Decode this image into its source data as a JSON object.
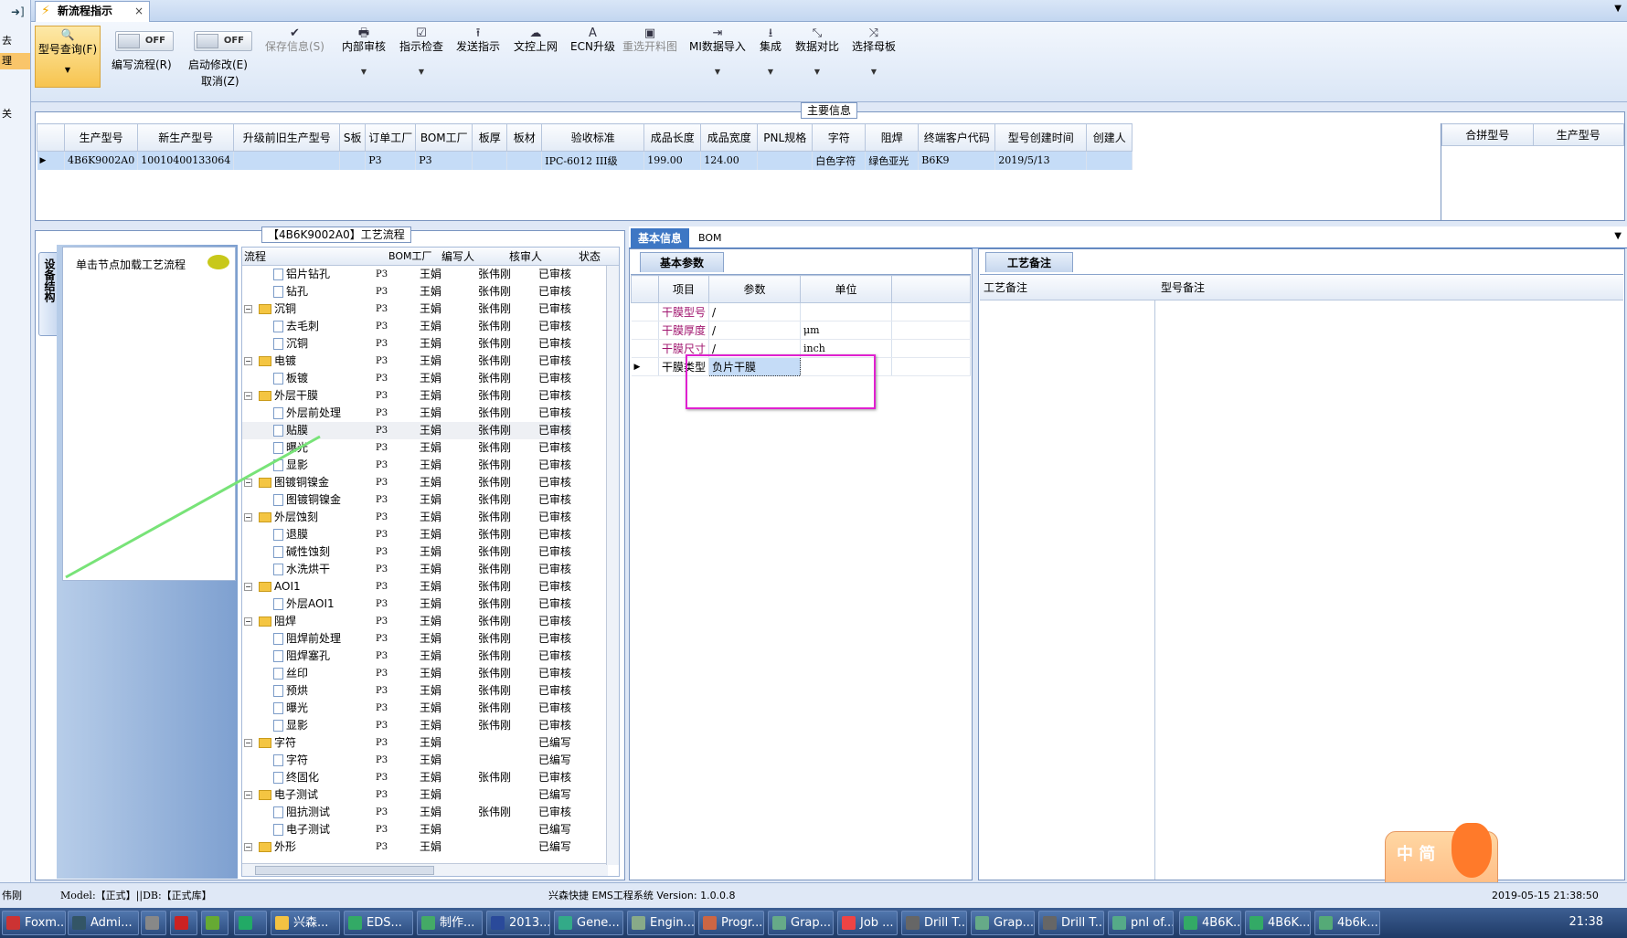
{
  "left_strip": {
    "items": [
      "去",
      "理",
      "关"
    ]
  },
  "tab": {
    "title": "新流程指示",
    "close": "×"
  },
  "ribbon": {
    "model_query": "型号查询(F)",
    "write_flow": "编写流程(R)",
    "start_modify": "启动修改(E)",
    "cancel": "取消(Z)",
    "toggle_off": "OFF",
    "buttons": [
      "保存信息(S)",
      "内部审核",
      "指示检查",
      "发送指示",
      "文控上网",
      "ECN升级",
      "重选开料图",
      "MI数据导入",
      "集成",
      "数据对比",
      "选择母板"
    ]
  },
  "main_info": {
    "section_title": "主要信息",
    "columns": [
      "生产型号",
      "新生产型号",
      "升级前旧生产型号",
      "S板",
      "订单工厂",
      "BOM工厂",
      "板厚",
      "板材",
      "验收标准",
      "成品长度",
      "成品宽度",
      "PNL规格",
      "字符",
      "阻焊",
      "终端客户代码",
      "型号创建时间",
      "创建人"
    ],
    "row": [
      "4B6K9002A0",
      "10010400133064",
      "",
      "",
      "P3",
      "P3",
      "",
      "",
      "IPC-6012 III级",
      "199.00",
      "124.00",
      "",
      "白色字符",
      "绿色亚光",
      "B6K9",
      "2019/5/13",
      ""
    ],
    "side_columns": [
      "合拼型号",
      "生产型号"
    ]
  },
  "flow_panel": {
    "title": "【4B6K9002A0】工艺流程",
    "vertical_tab": "设备结构",
    "hint": "单击节点加载工艺流程",
    "columns": [
      "流程",
      "BOM工厂",
      "编写人",
      "核审人",
      "状态"
    ],
    "rows": [
      {
        "level": 2,
        "type": "doc",
        "name": "铝片钻孔",
        "bom": "P3",
        "writer": "王娟",
        "reviewer": "张伟刚",
        "status": "已审核"
      },
      {
        "level": 2,
        "type": "doc",
        "name": "钻孔",
        "bom": "P3",
        "writer": "王娟",
        "reviewer": "张伟刚",
        "status": "已审核"
      },
      {
        "level": 1,
        "type": "folder",
        "name": "沉铜",
        "bom": "P3",
        "writer": "王娟",
        "reviewer": "张伟刚",
        "status": "已审核"
      },
      {
        "level": 2,
        "type": "doc",
        "name": "去毛刺",
        "bom": "P3",
        "writer": "王娟",
        "reviewer": "张伟刚",
        "status": "已审核"
      },
      {
        "level": 2,
        "type": "doc",
        "name": "沉铜",
        "bom": "P3",
        "writer": "王娟",
        "reviewer": "张伟刚",
        "status": "已审核"
      },
      {
        "level": 1,
        "type": "folder",
        "name": "电镀",
        "bom": "P3",
        "writer": "王娟",
        "reviewer": "张伟刚",
        "status": "已审核"
      },
      {
        "level": 2,
        "type": "doc",
        "name": "板镀",
        "bom": "P3",
        "writer": "王娟",
        "reviewer": "张伟刚",
        "status": "已审核"
      },
      {
        "level": 1,
        "type": "folder",
        "name": "外层干膜",
        "bom": "P3",
        "writer": "王娟",
        "reviewer": "张伟刚",
        "status": "已审核"
      },
      {
        "level": 2,
        "type": "doc",
        "name": "外层前处理",
        "bom": "P3",
        "writer": "王娟",
        "reviewer": "张伟刚",
        "status": "已审核"
      },
      {
        "level": 2,
        "type": "doc",
        "name": "贴膜",
        "bom": "P3",
        "writer": "王娟",
        "reviewer": "张伟刚",
        "status": "已审核"
      },
      {
        "level": 2,
        "type": "doc",
        "name": "曝光",
        "bom": "P3",
        "writer": "王娟",
        "reviewer": "张伟刚",
        "status": "已审核"
      },
      {
        "level": 2,
        "type": "doc",
        "name": "显影",
        "bom": "P3",
        "writer": "王娟",
        "reviewer": "张伟刚",
        "status": "已审核"
      },
      {
        "level": 1,
        "type": "folder",
        "name": "图镀铜镍金",
        "bom": "P3",
        "writer": "王娟",
        "reviewer": "张伟刚",
        "status": "已审核"
      },
      {
        "level": 2,
        "type": "doc",
        "name": "图镀铜镍金",
        "bom": "P3",
        "writer": "王娟",
        "reviewer": "张伟刚",
        "status": "已审核"
      },
      {
        "level": 1,
        "type": "folder",
        "name": "外层蚀刻",
        "bom": "P3",
        "writer": "王娟",
        "reviewer": "张伟刚",
        "status": "已审核"
      },
      {
        "level": 2,
        "type": "doc",
        "name": "退膜",
        "bom": "P3",
        "writer": "王娟",
        "reviewer": "张伟刚",
        "status": "已审核"
      },
      {
        "level": 2,
        "type": "doc",
        "name": "碱性蚀刻",
        "bom": "P3",
        "writer": "王娟",
        "reviewer": "张伟刚",
        "status": "已审核"
      },
      {
        "level": 2,
        "type": "doc",
        "name": "水洗烘干",
        "bom": "P3",
        "writer": "王娟",
        "reviewer": "张伟刚",
        "status": "已审核"
      },
      {
        "level": 1,
        "type": "folder",
        "name": "AOI1",
        "bom": "P3",
        "writer": "王娟",
        "reviewer": "张伟刚",
        "status": "已审核"
      },
      {
        "level": 2,
        "type": "doc",
        "name": "外层AOI1",
        "bom": "P3",
        "writer": "王娟",
        "reviewer": "张伟刚",
        "status": "已审核"
      },
      {
        "level": 1,
        "type": "folder",
        "name": "阻焊",
        "bom": "P3",
        "writer": "王娟",
        "reviewer": "张伟刚",
        "status": "已审核"
      },
      {
        "level": 2,
        "type": "doc",
        "name": "阻焊前处理",
        "bom": "P3",
        "writer": "王娟",
        "reviewer": "张伟刚",
        "status": "已审核"
      },
      {
        "level": 2,
        "type": "doc",
        "name": "阻焊塞孔",
        "bom": "P3",
        "writer": "王娟",
        "reviewer": "张伟刚",
        "status": "已审核"
      },
      {
        "level": 2,
        "type": "doc",
        "name": "丝印",
        "bom": "P3",
        "writer": "王娟",
        "reviewer": "张伟刚",
        "status": "已审核"
      },
      {
        "level": 2,
        "type": "doc",
        "name": "预烘",
        "bom": "P3",
        "writer": "王娟",
        "reviewer": "张伟刚",
        "status": "已审核"
      },
      {
        "level": 2,
        "type": "doc",
        "name": "曝光",
        "bom": "P3",
        "writer": "王娟",
        "reviewer": "张伟刚",
        "status": "已审核"
      },
      {
        "level": 2,
        "type": "doc",
        "name": "显影",
        "bom": "P3",
        "writer": "王娟",
        "reviewer": "张伟刚",
        "status": "已审核"
      },
      {
        "level": 1,
        "type": "folder",
        "name": "字符",
        "bom": "P3",
        "writer": "王娟",
        "reviewer": "",
        "status": "已编写"
      },
      {
        "level": 2,
        "type": "doc",
        "name": "字符",
        "bom": "P3",
        "writer": "王娟",
        "reviewer": "",
        "status": "已编写"
      },
      {
        "level": 2,
        "type": "doc",
        "name": "终固化",
        "bom": "P3",
        "writer": "王娟",
        "reviewer": "张伟刚",
        "status": "已审核"
      },
      {
        "level": 1,
        "type": "folder",
        "name": "电子测试",
        "bom": "P3",
        "writer": "王娟",
        "reviewer": "",
        "status": "已编写"
      },
      {
        "level": 2,
        "type": "doc",
        "name": "阻抗测试",
        "bom": "P3",
        "writer": "王娟",
        "reviewer": "张伟刚",
        "status": "已审核"
      },
      {
        "level": 2,
        "type": "doc",
        "name": "电子测试",
        "bom": "P3",
        "writer": "王娟",
        "reviewer": "",
        "status": "已编写"
      },
      {
        "level": 1,
        "type": "folder",
        "name": "外形",
        "bom": "P3",
        "writer": "王娟",
        "reviewer": "",
        "status": "已编写"
      }
    ]
  },
  "params_panel": {
    "tabs": [
      "基本信息",
      "BOM"
    ],
    "subtab": "基本参数",
    "columns": [
      "项目",
      "参数",
      "单位"
    ],
    "rows": [
      {
        "item": "干膜型号",
        "param": "/",
        "unit": ""
      },
      {
        "item": "干膜厚度",
        "param": "/",
        "unit": "μm"
      },
      {
        "item": "干膜尺寸",
        "param": "/",
        "unit": "inch"
      },
      {
        "item": "干膜类型",
        "param": "负片干膜",
        "unit": ""
      }
    ],
    "item_color": "#a0146e",
    "highlight_color": "#e020d0"
  },
  "notes_panel": {
    "tab": "工艺备注",
    "col1": "工艺备注",
    "col2": "型号备注"
  },
  "status_bar": {
    "user": "伟刚",
    "model": "Model:【正式】||DB:【正式库】",
    "app": "兴森快捷 EMS工程系统 Version: 1.0.0.8",
    "datetime": "2019-05-15 21:38:50"
  },
  "taskbar": {
    "items": [
      "Foxm...",
      "Admi...",
      "",
      "",
      "",
      "",
      "兴森...",
      "EDS...",
      "制作...",
      "2013...",
      "Gene...",
      "Engin...",
      "Progr...",
      "Grap...",
      "Job ...",
      "Drill T...",
      "Grap...",
      "Drill T...",
      "pnl of...",
      "4B6K...",
      "4B6K...",
      "4b6k..."
    ],
    "time": "21:38",
    "ime": "中 简"
  }
}
